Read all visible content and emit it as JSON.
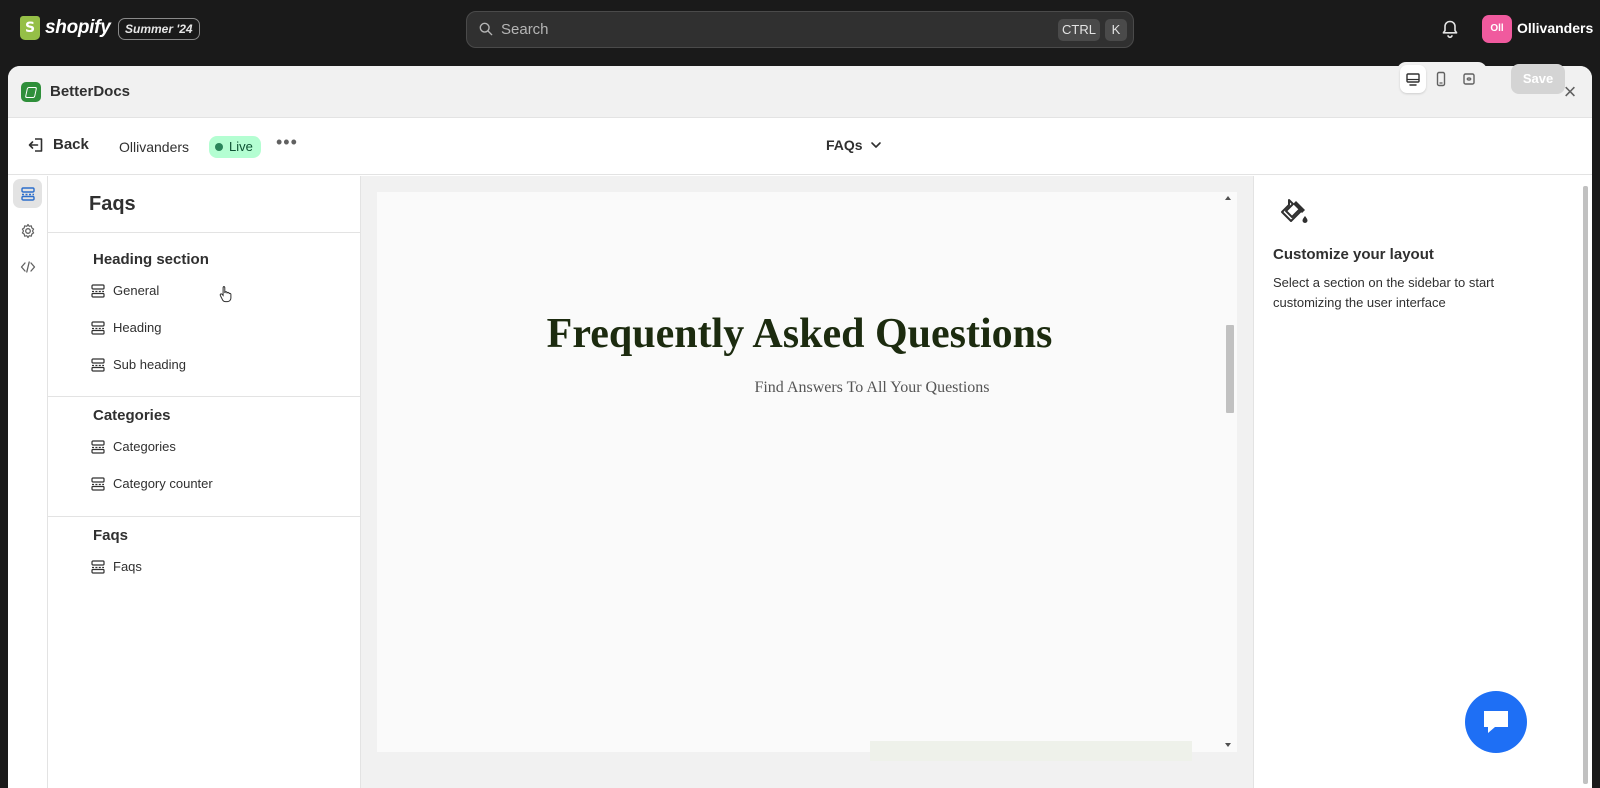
{
  "topbar": {
    "brand": "shopify",
    "edition": "Summer '24",
    "search_placeholder": "Search",
    "shortcut_ctrl": "CTRL",
    "shortcut_key": "K",
    "store_initials": "Oll",
    "store_name": "Ollivanders"
  },
  "app": {
    "title": "BetterDocs"
  },
  "toolbar": {
    "back_label": "Back",
    "store_label": "Ollivanders",
    "status_badge": "Live",
    "more_label": "•••",
    "page_selector": "FAQs",
    "save_label": "Save"
  },
  "sections": {
    "title": "Faqs",
    "groups": [
      {
        "title": "Heading section",
        "items": [
          "General",
          "Heading",
          "Sub heading"
        ]
      },
      {
        "title": "Categories",
        "items": [
          "Categories",
          "Category counter"
        ]
      },
      {
        "title": "Faqs",
        "items": [
          "Faqs"
        ]
      }
    ]
  },
  "preview": {
    "heading": "Frequently Asked Questions",
    "subheading": "Find Answers To All Your Questions"
  },
  "right_panel": {
    "title": "Customize your layout",
    "description": "Select a section on the sidebar to start customizing the user interface"
  },
  "colors": {
    "topbar_bg": "#1a1a1a",
    "live_badge_bg": "#b4fed2",
    "heading_color": "#1c2b0f",
    "chat_button": "#1e6ff5",
    "app_icon": "#2f8f3a"
  },
  "icons": [
    "search-icon",
    "bell-icon",
    "close-icon",
    "back-icon",
    "chevron-down-icon",
    "desktop-icon",
    "mobile-icon",
    "fullscreen-icon",
    "sections-icon",
    "gear-icon",
    "code-icon",
    "section-item-icon",
    "paint-bucket-icon",
    "chat-icon"
  ]
}
